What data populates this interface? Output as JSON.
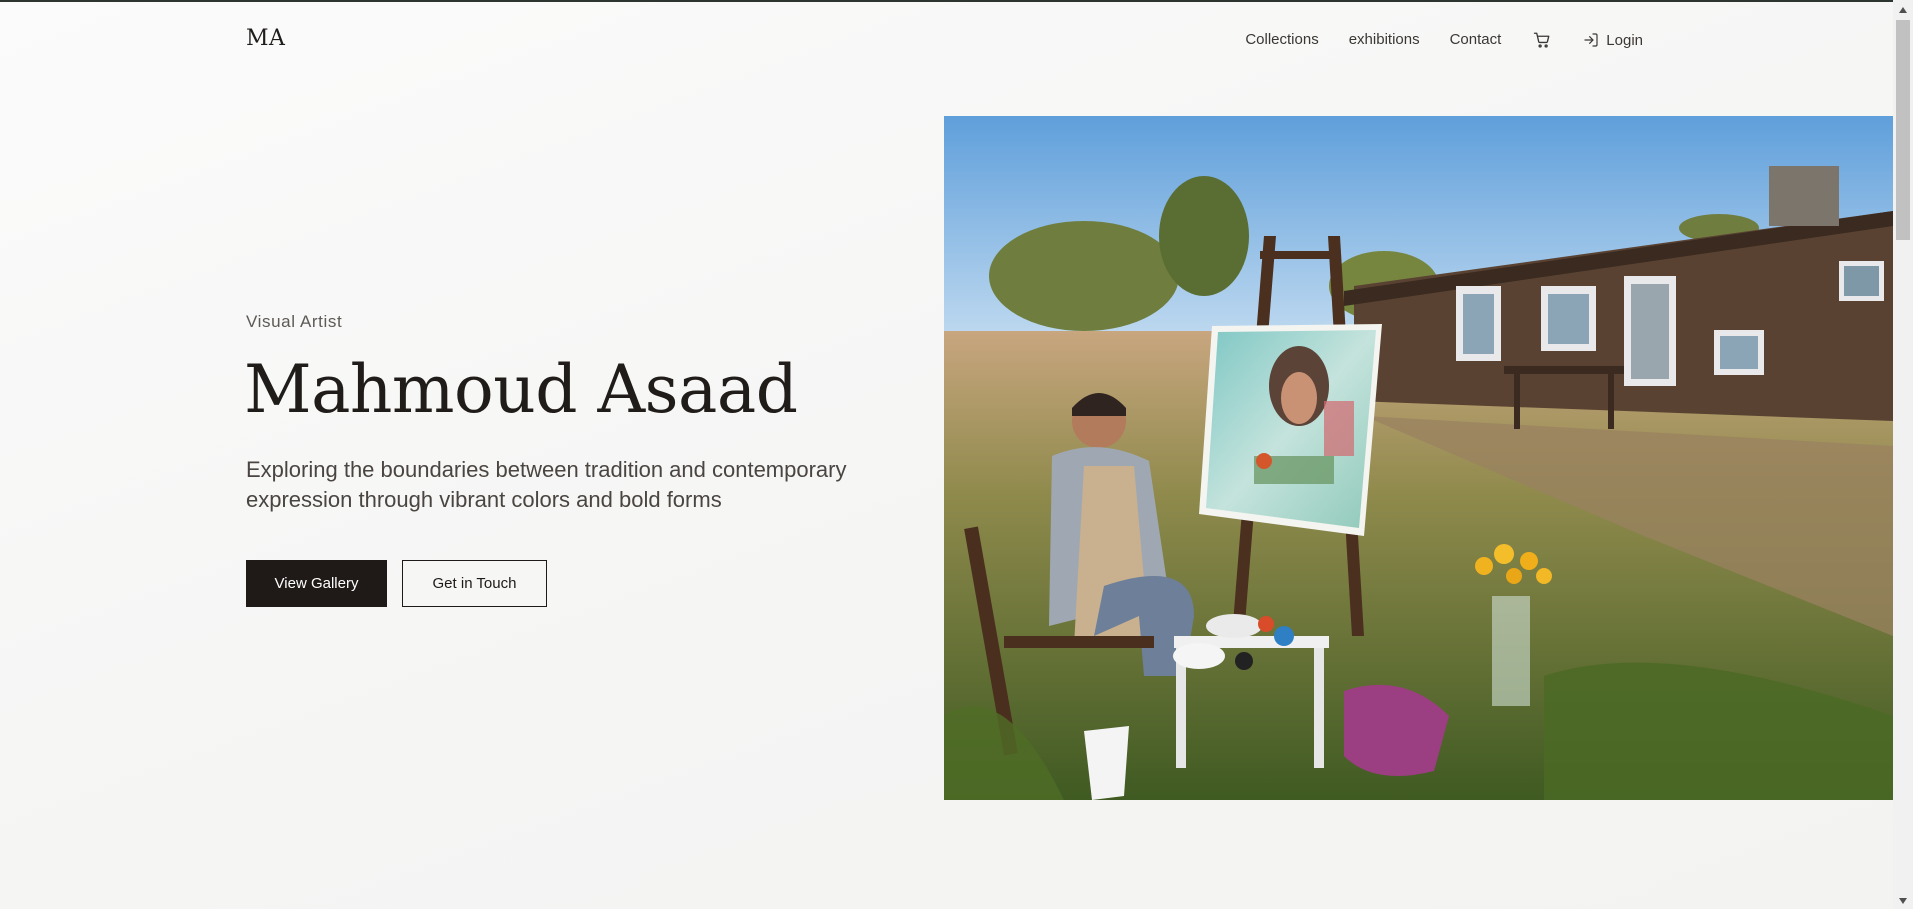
{
  "header": {
    "logo": "MA",
    "nav": {
      "collections": "Collections",
      "exhibitions": "exhibitions",
      "contact": "Contact",
      "login": "Login"
    },
    "icons": {
      "cart": "cart-icon",
      "login": "login-icon"
    }
  },
  "hero": {
    "eyebrow": "Visual Artist",
    "title": "Mahmoud Asaad",
    "description": "Exploring the boundaries between tradition and contemporary expression through vibrant colors and bold forms",
    "primary_button": "View Gallery",
    "secondary_button": "Get in Touch"
  },
  "colors": {
    "primary_dark": "#1f1a17",
    "background": "#f7f7f6",
    "text": "#2a2624"
  }
}
